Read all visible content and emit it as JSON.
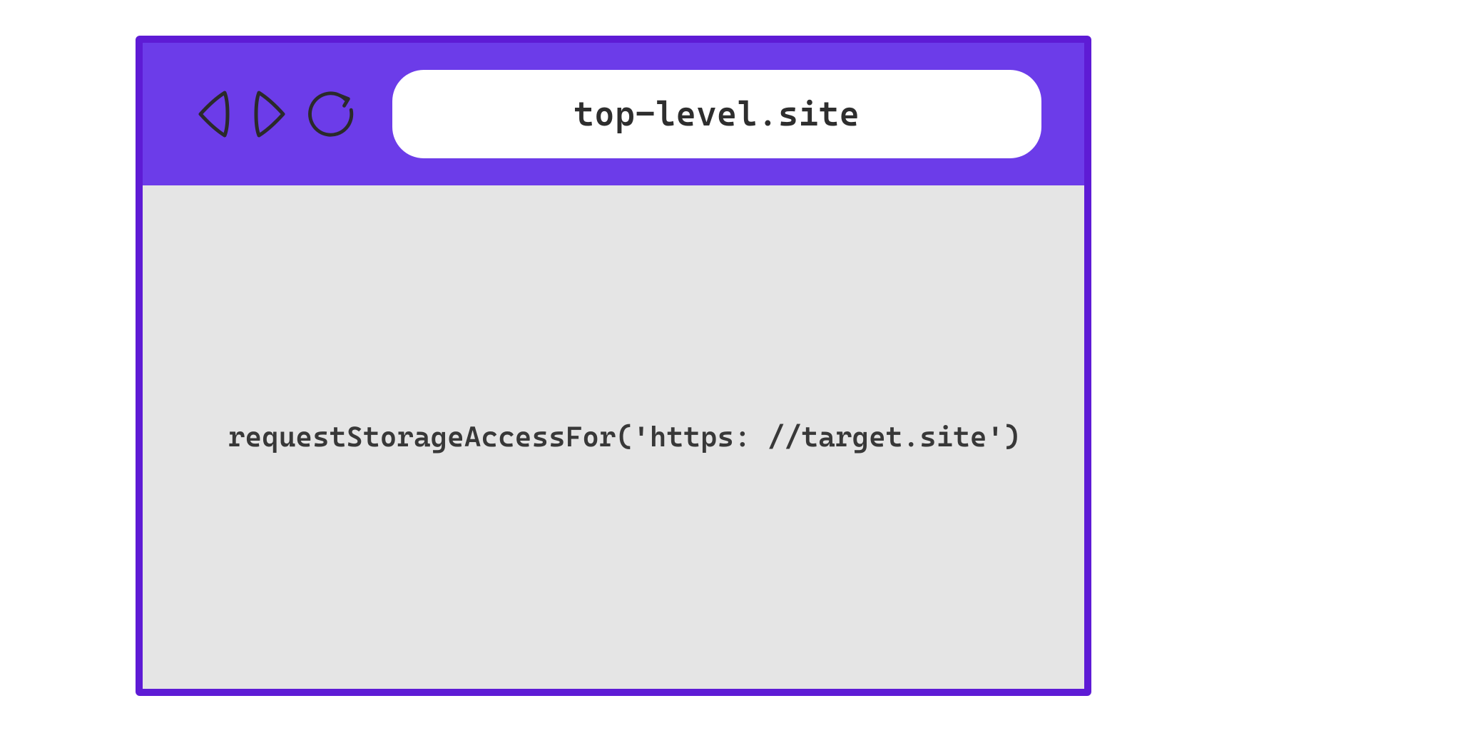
{
  "browser": {
    "address": "top-level.site",
    "icons": {
      "back": "back-icon",
      "forward": "forward-icon",
      "refresh": "refresh-icon"
    }
  },
  "content": {
    "code": "requestStorageAccessFor('https: //target.site')"
  },
  "colors": {
    "accent": "#6c3ce9",
    "border": "#5e1bd5",
    "content_bg": "#e5e5e5",
    "text": "#2e2e2e"
  }
}
